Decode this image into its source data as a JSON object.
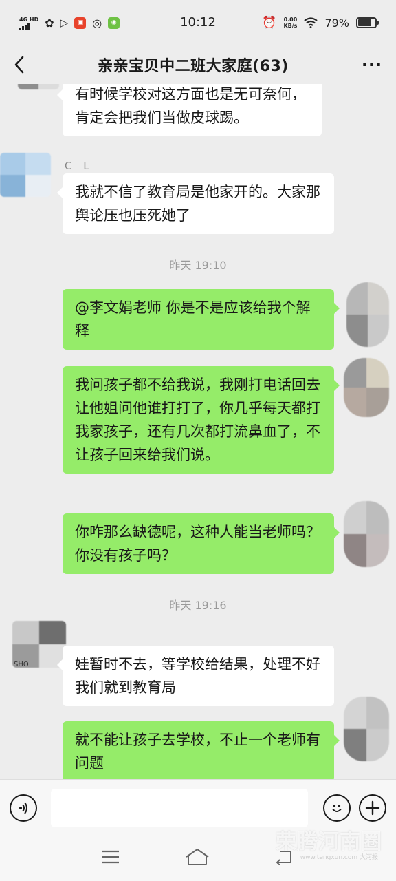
{
  "status_bar": {
    "network": "4G HD",
    "time": "10:12",
    "speed_value": "0.00",
    "speed_unit": "KB/s",
    "battery": "79%",
    "battery_level": 0.79
  },
  "header": {
    "title": "亲亲宝贝中二班大家庭(63)",
    "more": "···"
  },
  "messages": [
    {
      "side": "left",
      "sender": "",
      "text": "有时候学校对这方面也是无可奈何，肯定会把我们当做皮球踢。"
    },
    {
      "side": "left",
      "sender": "C L",
      "text": "我就不信了教育局是他家开的。大家那舆论压也压死她了"
    },
    {
      "side": "right",
      "text": "@李文娟老师  你是不是应该给我个解释"
    },
    {
      "side": "right",
      "text": "我问孩子都不给我说，我刚打电话回去让他姐问他谁打打了，你几乎每天都打我家孩子，还有几次都打流鼻血了，不让孩子回来给我们说。"
    },
    {
      "side": "right",
      "text": "你咋那么缺德呢，这种人能当老师吗？你没有孩子吗？"
    },
    {
      "side": "left",
      "sender": "",
      "text": "娃暂时不去，等学校给结果，处理不好我们就到教育局"
    },
    {
      "side": "right",
      "text": "就不能让孩子去学校，不止一个老师有问题"
    }
  ],
  "timestamps": [
    "昨天 19:10",
    "昨天 19:16"
  ],
  "avatar_overlay_text": "SHO",
  "input": {
    "value": "",
    "placeholder": ""
  },
  "watermark": {
    "main": "荣腾河南圈",
    "sub": "www.tengxun.com 大河报"
  },
  "colors": {
    "my_bubble": "#95ec69",
    "their_bubble": "#ffffff",
    "background": "#ededed"
  }
}
